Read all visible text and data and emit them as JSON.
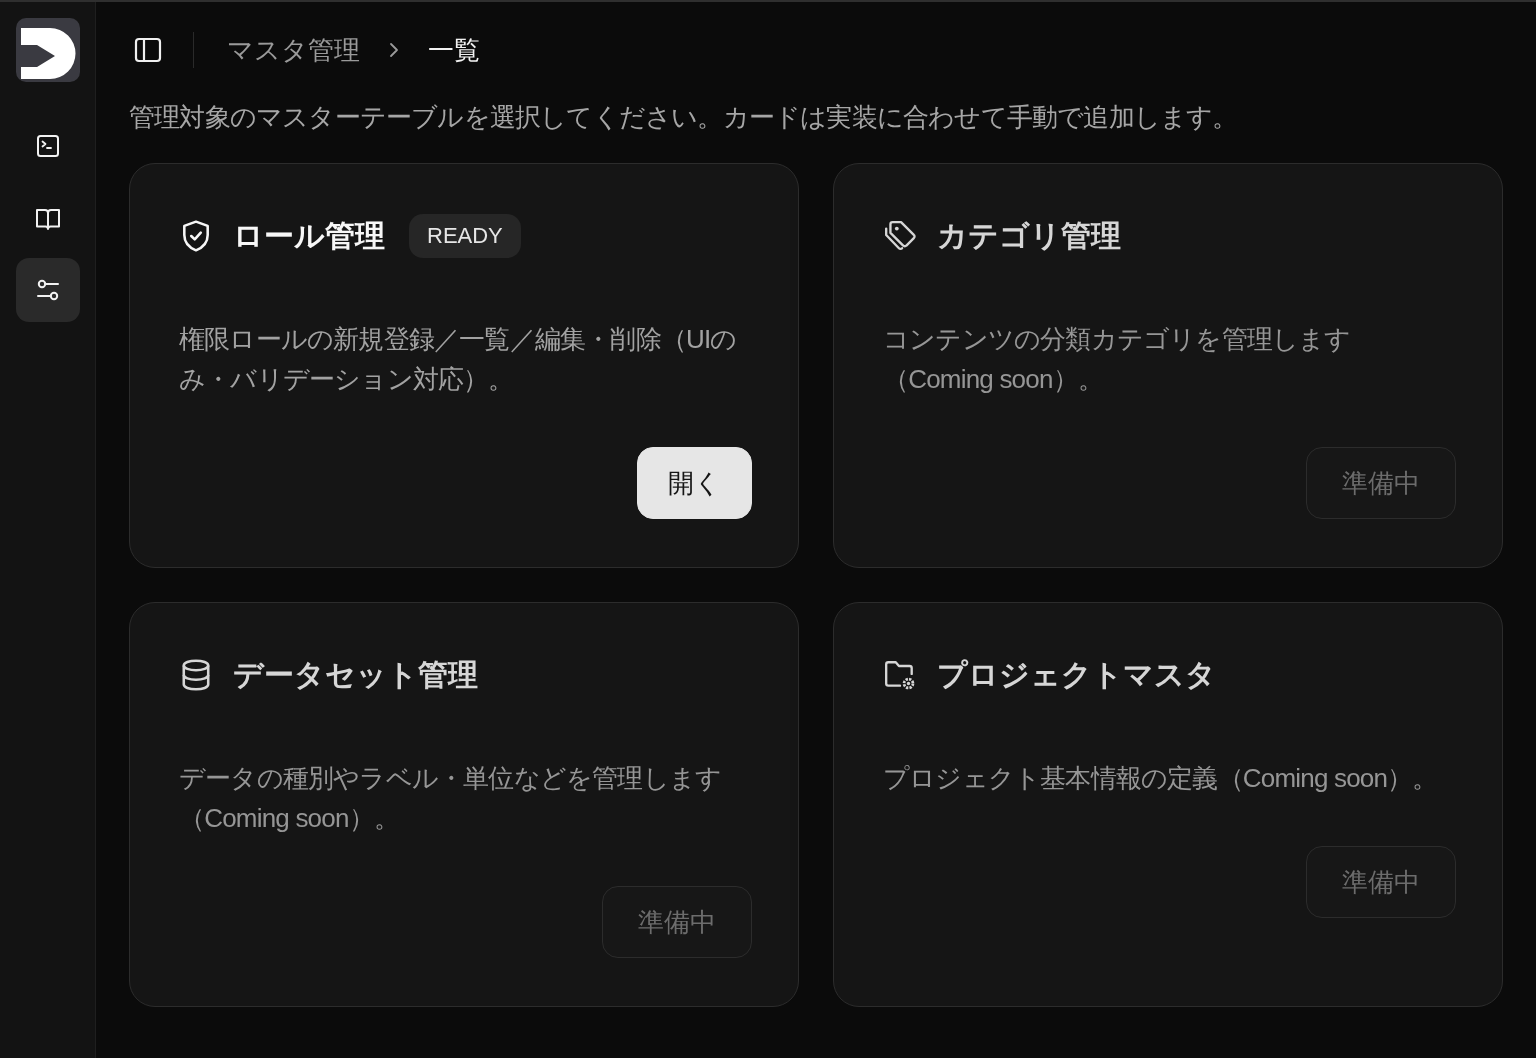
{
  "sidebar": {
    "nav_items": [
      {
        "selected": false
      },
      {
        "selected": false
      },
      {
        "selected": true
      }
    ]
  },
  "breadcrumb": [
    {
      "label": "マスタ管理",
      "current": false
    },
    {
      "label": "一覧",
      "current": true
    }
  ],
  "description": "管理対象のマスターテーブルを選択してください。カードは実装に合わせて手動で追加します。",
  "cards": [
    {
      "title": "ロール管理",
      "badge": "READY",
      "description": "権限ロールの新規登録／一覧／編集・削除（UIのみ・バリデーション対応）。",
      "button": {
        "label": "開く",
        "disabled": false
      }
    },
    {
      "title": "カテゴリ管理",
      "description": "コンテンツの分類カテゴリを管理します（Coming soon）。",
      "button": {
        "label": "準備中",
        "disabled": true
      }
    },
    {
      "title": "データセット管理",
      "description": "データの種別やラベル・単位などを管理します（Coming soon）。",
      "button": {
        "label": "準備中",
        "disabled": true
      }
    },
    {
      "title": "プロジェクトマスタ",
      "description": "プロジェクト基本情報の定義（Coming soon）。",
      "button": {
        "label": "準備中",
        "disabled": true
      }
    }
  ]
}
